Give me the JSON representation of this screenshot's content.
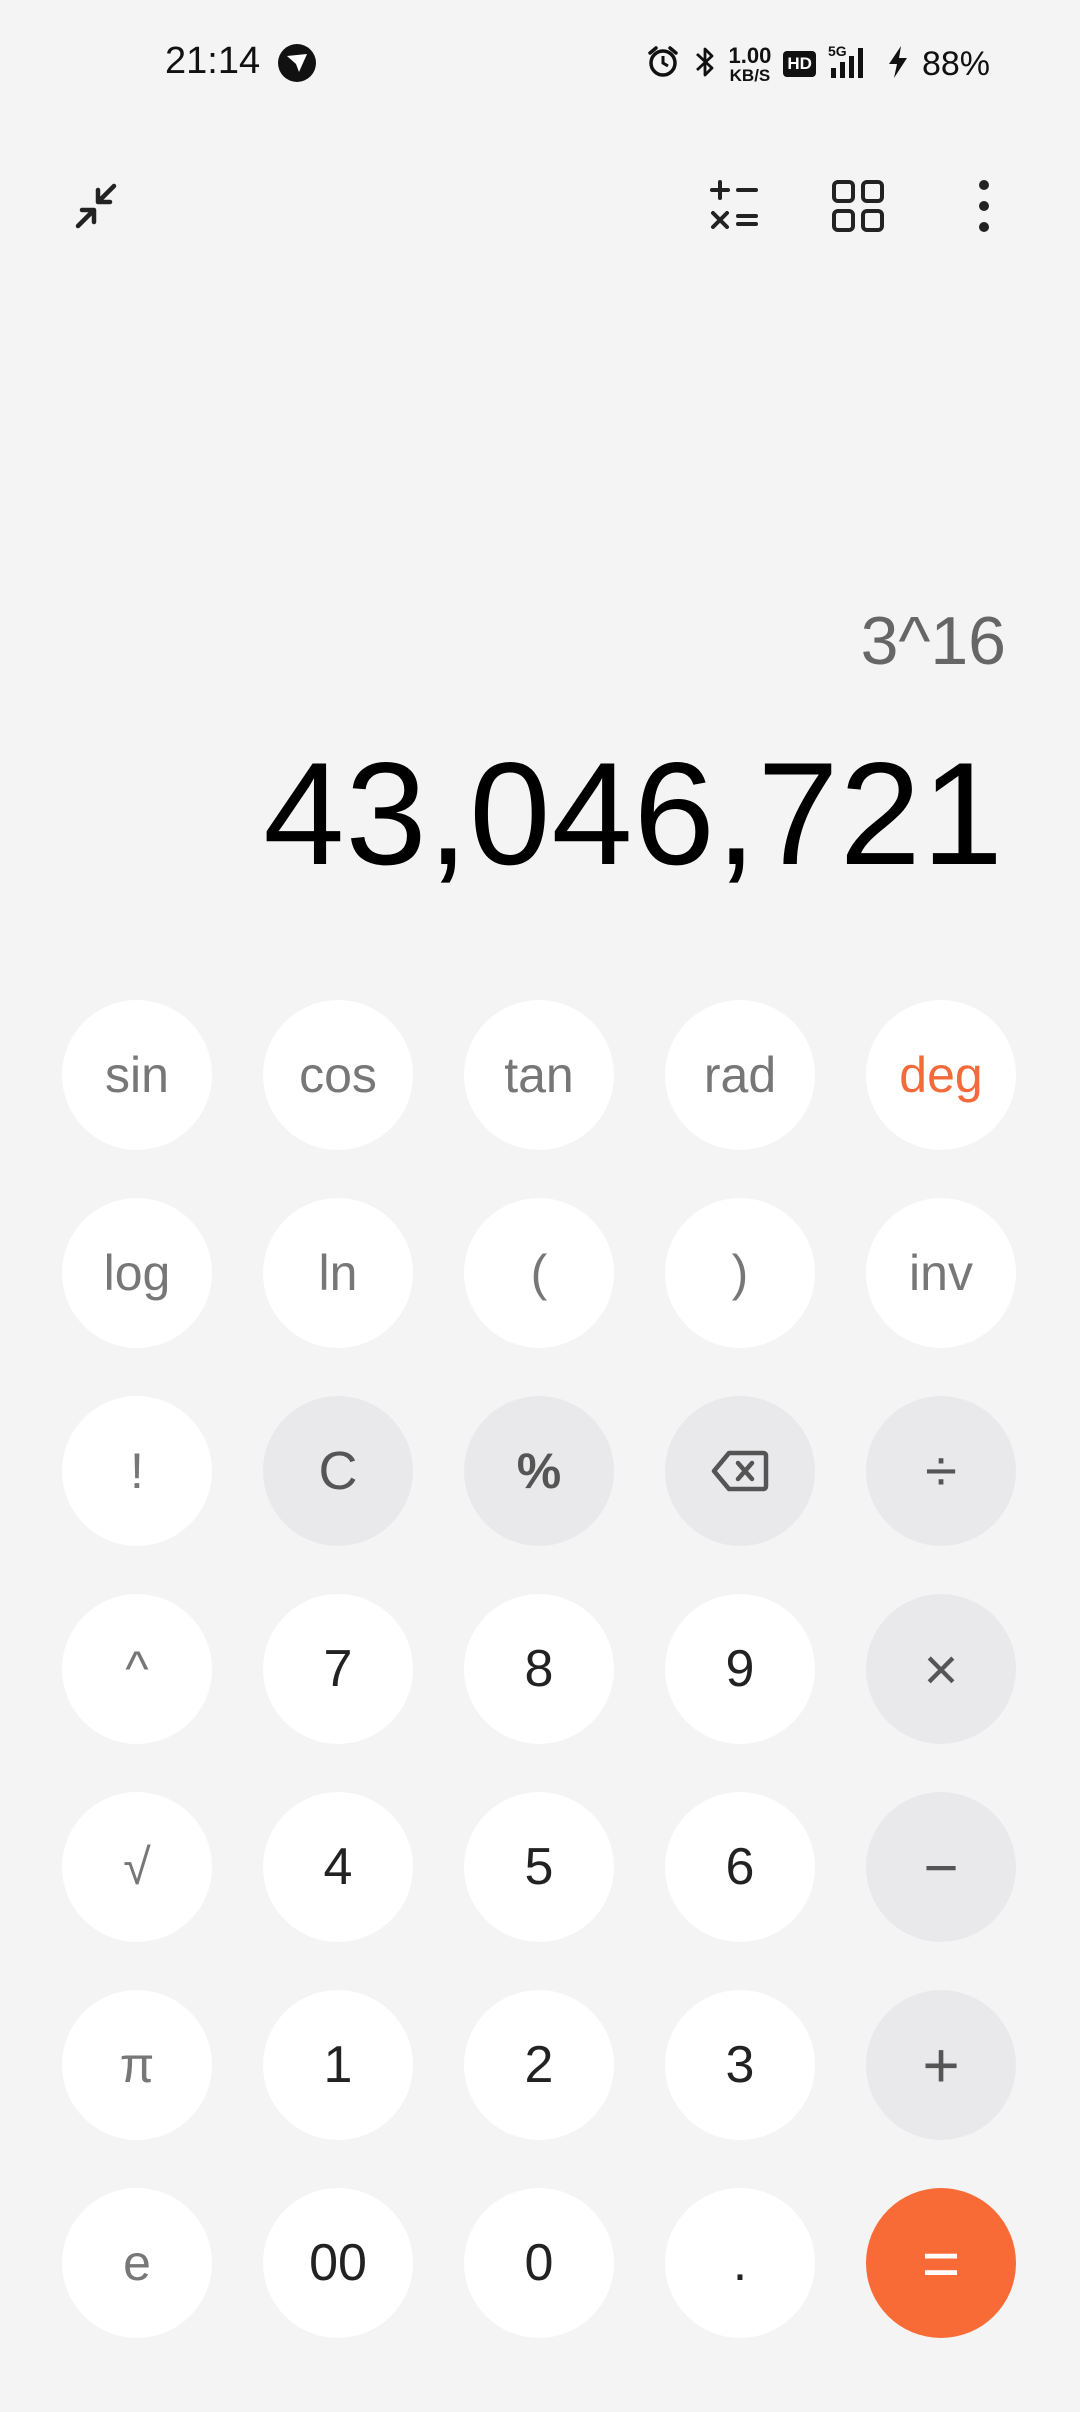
{
  "status_bar": {
    "time": "21:14",
    "net_speed_value": "1.00",
    "net_speed_unit": "KB/S",
    "hd_label": "HD",
    "network_label": "5G",
    "battery": "88%",
    "icons": [
      "alarm-icon",
      "bluetooth-icon",
      "hd-icon",
      "signal-icon",
      "charging-icon"
    ]
  },
  "toolbar": {
    "icons": [
      "collapse-icon",
      "unit-converter-icon",
      "grid-icon",
      "more-icon"
    ]
  },
  "display": {
    "expression": "3^16",
    "result": "43,046,721"
  },
  "keypad": {
    "rows": [
      [
        "sin",
        "cos",
        "tan",
        "rad",
        "deg"
      ],
      [
        "log",
        "ln",
        "(",
        ")",
        "inv"
      ],
      [
        "!",
        "C",
        "%",
        "backspace",
        "÷"
      ],
      [
        "^",
        "7",
        "8",
        "9",
        "×"
      ],
      [
        "√",
        "4",
        "5",
        "6",
        "−"
      ],
      [
        "π",
        "1",
        "2",
        "3",
        "+"
      ],
      [
        "e",
        "00",
        "0",
        ".",
        "="
      ]
    ],
    "sin": "sin",
    "cos": "cos",
    "tan": "tan",
    "rad": "rad",
    "deg": "deg",
    "log": "log",
    "ln": "ln",
    "lparen": "(",
    "rparen": ")",
    "inv": "inv",
    "fact": "!",
    "clear": "C",
    "percent": "%",
    "divide": "÷",
    "pow": "^",
    "seven": "7",
    "eight": "8",
    "nine": "9",
    "multiply": "×",
    "sqrt": "√",
    "four": "4",
    "five": "5",
    "six": "6",
    "minus": "−",
    "pi": "π",
    "one": "1",
    "two": "2",
    "three": "3",
    "plus": "+",
    "e": "e",
    "doublezero": "00",
    "zero": "0",
    "dot": ".",
    "equals": "="
  },
  "colors": {
    "background": "#f4f4f4",
    "key": "#ffffff",
    "operator_key": "#e9e9eb",
    "accent": "#f36a3b",
    "equals": "#f96b36"
  }
}
